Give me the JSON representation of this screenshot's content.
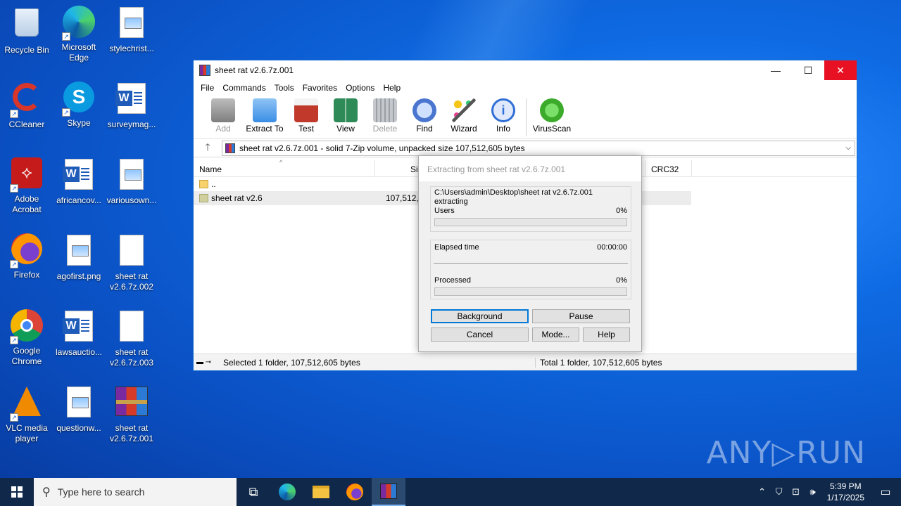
{
  "desktop": {
    "icons": [
      {
        "label": "Recycle Bin"
      },
      {
        "label": "Microsoft Edge"
      },
      {
        "label": "stylechrist..."
      },
      {
        "label": "CCleaner"
      },
      {
        "label": "Skype"
      },
      {
        "label": "surveymag..."
      },
      {
        "label": "Adobe Acrobat"
      },
      {
        "label": "africancov..."
      },
      {
        "label": "variousown..."
      },
      {
        "label": "Firefox"
      },
      {
        "label": "agofirst.png"
      },
      {
        "label": "sheet rat v2.6.7z.002"
      },
      {
        "label": "Google Chrome"
      },
      {
        "label": "lawsauctio..."
      },
      {
        "label": "sheet rat v2.6.7z.003"
      },
      {
        "label": "VLC media player"
      },
      {
        "label": "questionw..."
      },
      {
        "label": "sheet rat v2.6.7z.001"
      }
    ],
    "watermark": "ANY▷RUN"
  },
  "window": {
    "title": "sheet rat v2.6.7z.001",
    "minimize": "—",
    "maximize": "☐",
    "close": "✕",
    "menu": [
      "File",
      "Commands",
      "Tools",
      "Favorites",
      "Options",
      "Help"
    ],
    "toolbar": [
      {
        "label": "Add",
        "disabled": true,
        "color": "#8a8a8a"
      },
      {
        "label": "Extract To",
        "disabled": false,
        "color": "#3a8ee6"
      },
      {
        "label": "Test",
        "disabled": false,
        "color": "#c0392b"
      },
      {
        "label": "View",
        "disabled": false,
        "color": "#2e8b57"
      },
      {
        "label": "Delete",
        "disabled": true,
        "color": "#9aa0a6"
      },
      {
        "label": "Find",
        "disabled": false,
        "color": "#4a76d0"
      },
      {
        "label": "Wizard",
        "disabled": false,
        "color": "#7a5ab8"
      },
      {
        "label": "Info",
        "disabled": false,
        "color": "#2f6fd6"
      },
      {
        "label": "VirusScan",
        "disabled": false,
        "color": "#3caa2a"
      }
    ],
    "address": {
      "up": "🡑",
      "path": "sheet rat v2.6.7z.001 - solid 7-Zip volume, unpacked size 107,512,605 bytes",
      "dropdown": "⌵"
    },
    "columns": {
      "name": "Name",
      "size": "Si",
      "crc": "CRC32"
    },
    "files": [
      {
        "name": "..",
        "size": ""
      },
      {
        "name": "sheet rat v2.6",
        "size": "107,512,6"
      }
    ],
    "status": {
      "left": "Selected 1 folder, 107,512,605 bytes",
      "right": "Total 1 folder, 107,512,605 bytes"
    }
  },
  "dialog": {
    "title": "Extracting from sheet rat v2.6.7z.001",
    "path": "C:\\Users\\admin\\Desktop\\sheet rat v2.6.7z.001",
    "action": "extracting",
    "current_label": "Users",
    "current_pct": "0%",
    "current_progress": 0,
    "elapsed_label": "Elapsed time",
    "elapsed_value": "00:00:00",
    "processed_label": "Processed",
    "processed_pct": "0%",
    "processed_progress": 0,
    "buttons": {
      "background": "Background",
      "pause": "Pause",
      "cancel": "Cancel",
      "mode": "Mode...",
      "help": "Help"
    }
  },
  "taskbar": {
    "search_placeholder": "Type here to search",
    "time": "5:39 PM",
    "date": "1/17/2025"
  }
}
